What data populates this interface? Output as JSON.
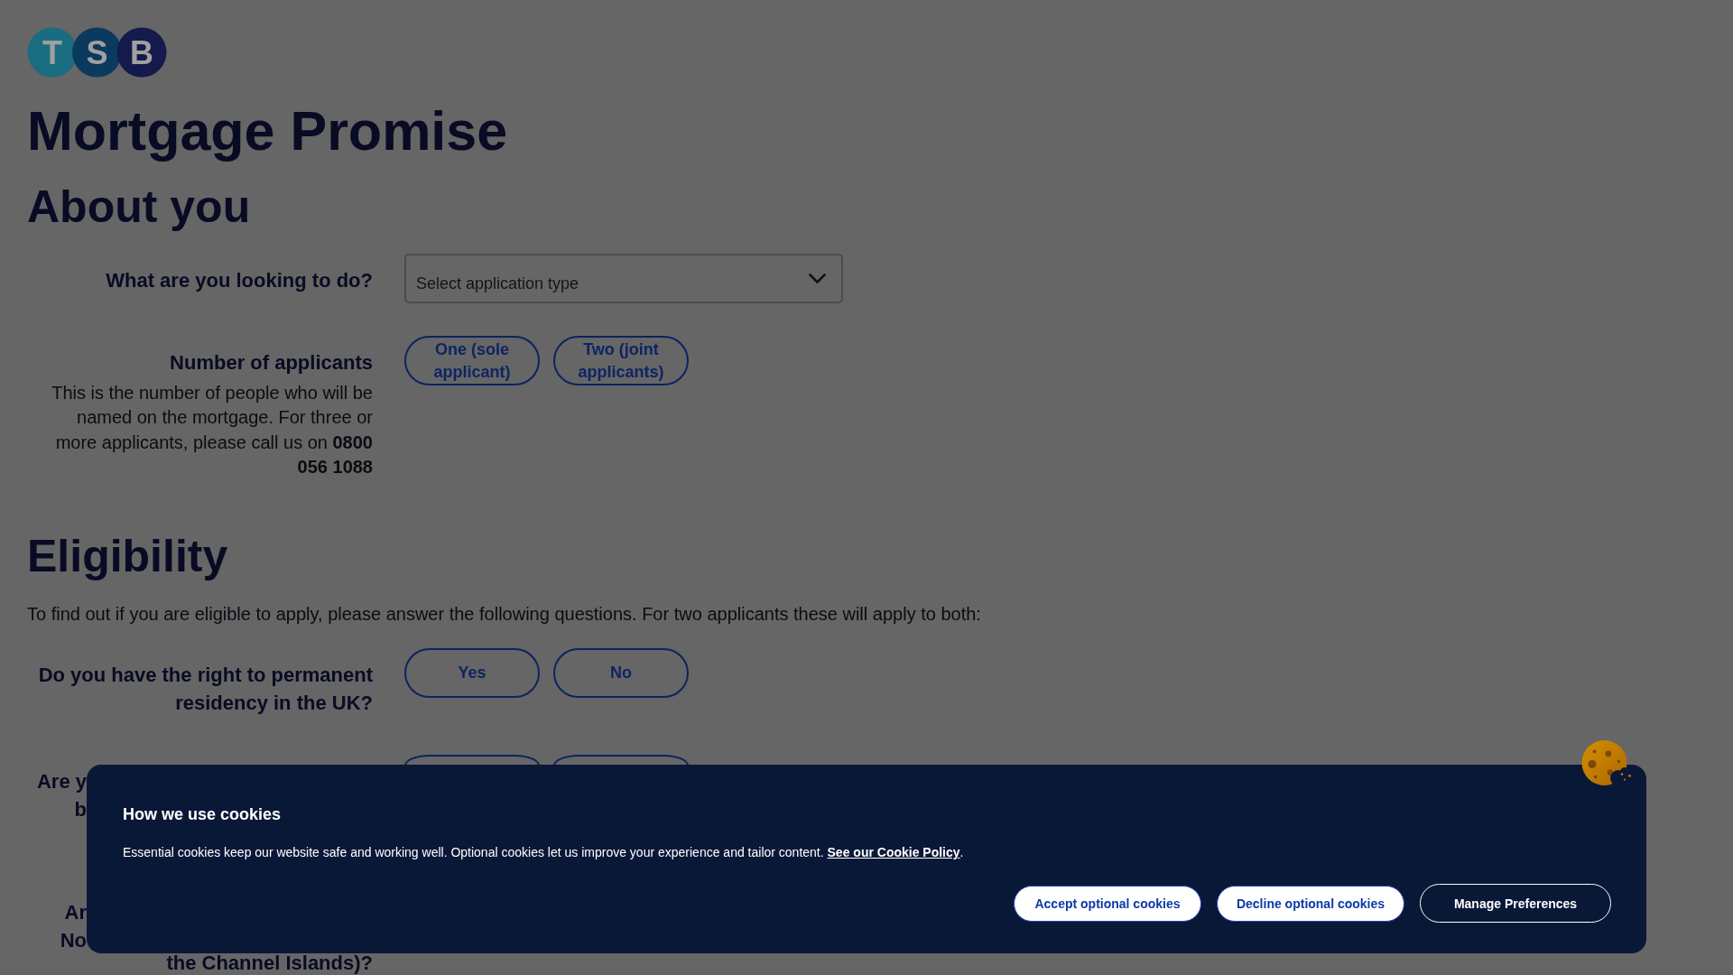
{
  "logo": {
    "letters": [
      "T",
      "S",
      "B"
    ]
  },
  "page_title": "Mortgage Promise",
  "about_you": {
    "heading": "About you",
    "application_type": {
      "label": "What are you looking to do?",
      "placeholder": "Select application type"
    },
    "applicants": {
      "label": "Number of applicants",
      "help": "This is the number of people who will be named on the mortgage. For three or more applicants, please call us on **0800 056 1088**",
      "options": [
        {
          "label": "One (sole applicant)",
          "selected": false
        },
        {
          "label": "Two (joint applicants)",
          "selected": false
        }
      ]
    }
  },
  "eligibility": {
    "heading": "Eligibility",
    "intro": "To find out if you are eligible to apply, please answer the following questions. For two applicants these will apply to both:",
    "questions": [
      {
        "kind": "full",
        "label": "Do you have the right to permanent residency in the UK?",
        "options": [
          {
            "label": "Yes",
            "selected": false
          },
          {
            "label": "No",
            "selected": false
          }
        ]
      },
      {
        "kind": "covered",
        "label_lines": [
          "Are y",
          "b"
        ],
        "options": [
          {
            "selected": false
          },
          {
            "selected": false
          }
        ]
      },
      {
        "kind": "covered",
        "label_lines": [
          "Ar",
          "No"
        ],
        "last_line": "the Channel Islands)?"
      }
    ]
  },
  "cookie_banner": {
    "title": "How we use cookies",
    "text": "Essential cookies keep our website safe and working well. Optional cookies let us improve your experience and tailor content.",
    "link": "See our Cookie Policy",
    "text_end": ".",
    "buttons": [
      {
        "kind": "accept",
        "label": "Accept optional cookies"
      },
      {
        "kind": "decline",
        "label": "Decline optional cookies"
      },
      {
        "kind": "manage",
        "label": "Manage Preferences"
      }
    ]
  }
}
